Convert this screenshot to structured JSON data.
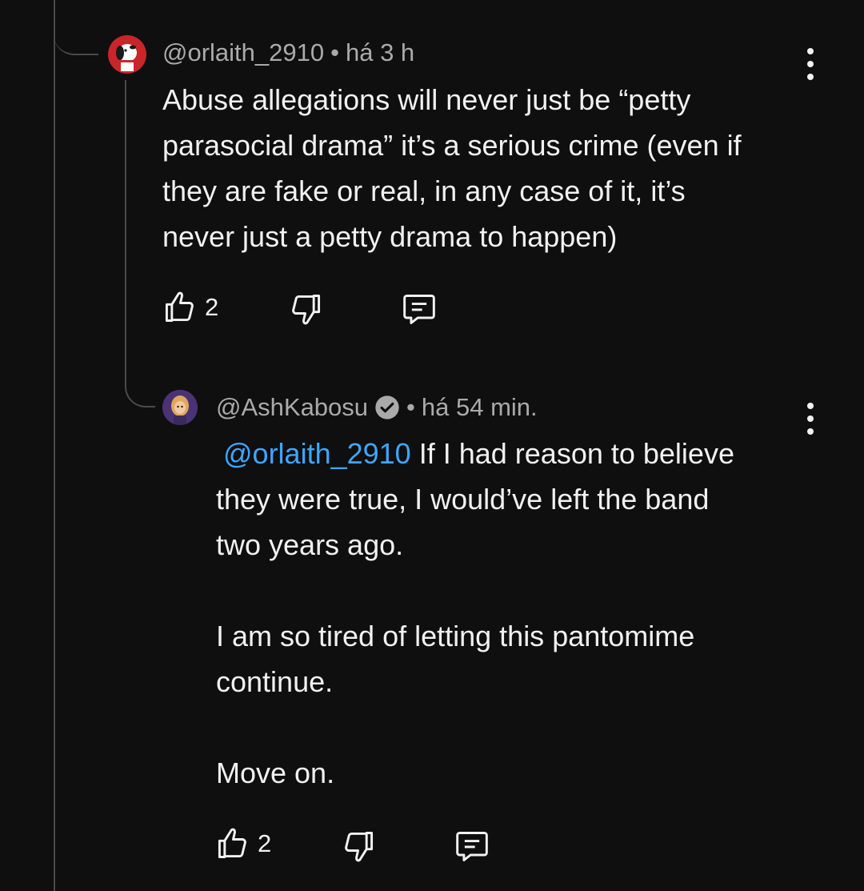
{
  "comment1": {
    "author": "@orlaith_2910",
    "separator": "•",
    "time": "há 3 h",
    "text": "Abuse allegations will never just be “petty\nparasocial drama” it’s a serious crime (even if\nthey are fake or real, in any case of it, it’s\nnever just a petty drama to happen)",
    "likes": "2",
    "avatar_icon": "snoopy-avatar"
  },
  "comment2": {
    "author": "@AshKabosu",
    "verified_icon": "verified-check-icon",
    "separator": "•",
    "time": "há 54 min.",
    "mention": "@orlaith_2910",
    "text_after_mention": " If I had reason to believe\nthey were true, I would’ve left the band\ntwo years ago.\n\nI am so tired of letting this pantomime\ncontinue.\n\nMove on.",
    "likes": "2",
    "avatar_icon": "cartoon-girl-avatar"
  },
  "colors": {
    "background": "#0f0f0f",
    "text": "#f1f1f1",
    "secondary": "#aaaaaa",
    "link": "#3ea6ff",
    "thread": "#4a4a4a"
  }
}
